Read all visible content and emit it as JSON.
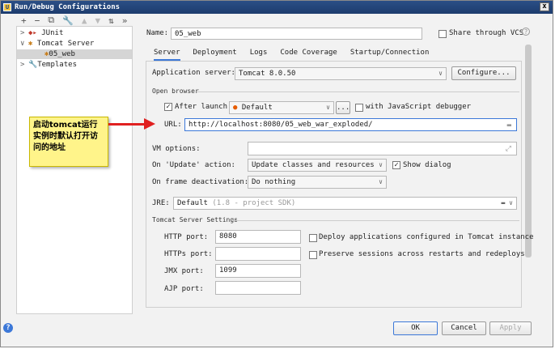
{
  "window": {
    "title": "Run/Debug Configurations",
    "close": "x"
  },
  "toolbar": {
    "add": "+",
    "remove": "−",
    "copy": "⧉",
    "edit": "🔧",
    "up": "▲",
    "down": "▼",
    "sort": "⇅",
    "more": "»"
  },
  "tree": {
    "items": [
      {
        "label": "JUnit",
        "arrow": ">"
      },
      {
        "label": "Tomcat Server",
        "arrow": "∨"
      },
      {
        "label": "05_web",
        "arrow": ""
      },
      {
        "label": "Templates",
        "arrow": ">"
      }
    ]
  },
  "name": {
    "label": "Name:",
    "value": "05_web"
  },
  "share": {
    "label": "Share through VCS",
    "help": "?"
  },
  "tabs": [
    "Server",
    "Deployment",
    "Logs",
    "Code Coverage",
    "Startup/Connection"
  ],
  "app_server": {
    "label": "Application server:",
    "value": "Tomcat 8.0.50",
    "configure": "Configure..."
  },
  "open_browser": {
    "section": "Open browser",
    "after_launch": "After launch",
    "browser": "Default",
    "ellipsis": "...",
    "js_debugger": "with JavaScript debugger",
    "url_label": "URL:",
    "url_value": "http://localhost:8080/05_web_war_exploded/"
  },
  "vm_options": {
    "label": "VM options:",
    "value": "",
    "expand": "⤢"
  },
  "on_update": {
    "label": "On 'Update' action:",
    "value": "Update classes and resources",
    "show_dialog": "Show dialog"
  },
  "on_frame": {
    "label": "On frame deactivation:",
    "value": "Do nothing"
  },
  "jre": {
    "label": "JRE:",
    "value": "Default",
    "hint": "(1.8 - project SDK)"
  },
  "tomcat_settings": {
    "section": "Tomcat Server Settings",
    "http_label": "HTTP port:",
    "http_value": "8080",
    "https_label": "HTTPs port:",
    "https_value": "",
    "jmx_label": "JMX port:",
    "jmx_value": "1099",
    "ajp_label": "AJP port:",
    "ajp_value": "",
    "deploy_label": "Deploy applications configured in Tomcat instance",
    "preserve_label": "Preserve sessions across restarts and redeploys"
  },
  "callout": {
    "text": "启动tomcat运行实例时默认打开访问的地址"
  },
  "footer": {
    "ok": "OK",
    "cancel": "Cancel",
    "apply": "Apply",
    "help": "?"
  },
  "colors": {
    "accent": "#3c78d8",
    "title_bar": "#1d3c6e",
    "callout_bg": "#fff48a",
    "arrow": "#e02020"
  }
}
